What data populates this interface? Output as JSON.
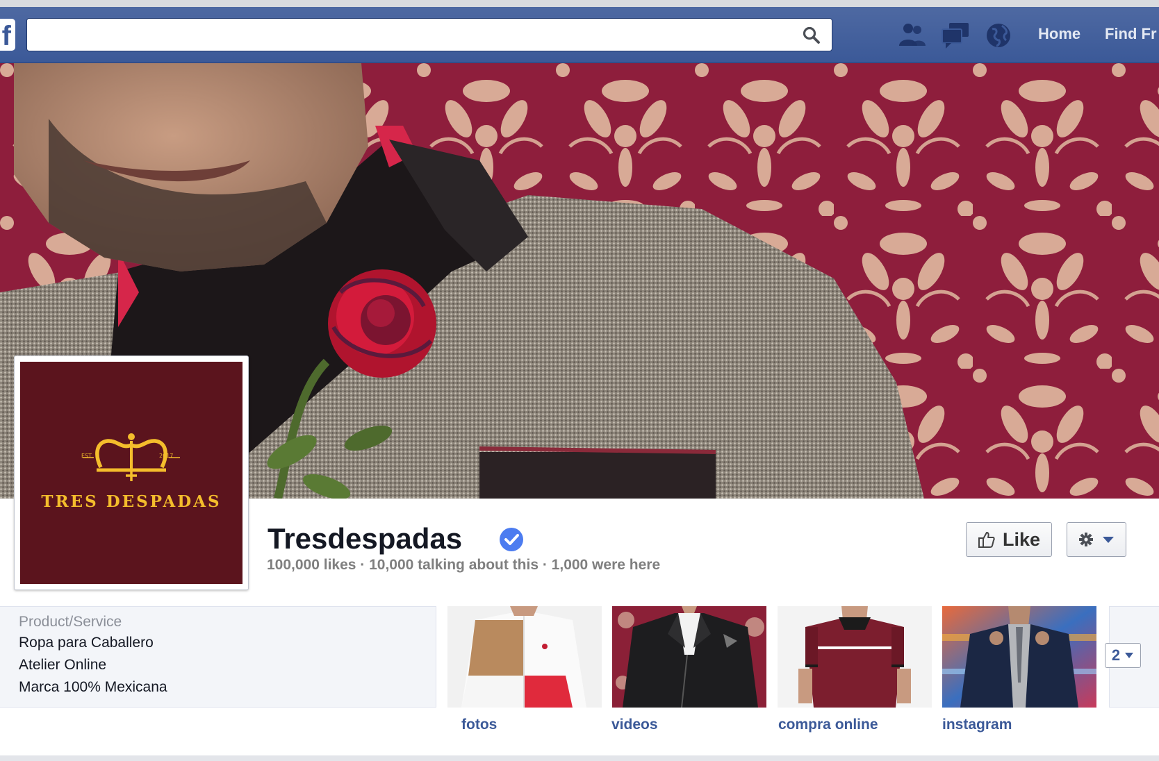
{
  "topbar": {
    "logo": "f",
    "search": {
      "value": "",
      "placeholder": ""
    },
    "nav": {
      "home": "Home",
      "find_friends": "Find Fr"
    },
    "icons": [
      "friend-requests-icon",
      "messages-icon",
      "notifications-globe-icon"
    ]
  },
  "cover": {
    "description_icon": "cover-photo"
  },
  "profile": {
    "brand_text": "TRES DESPADAS",
    "est_left": "EST.",
    "est_right": "2017",
    "background_color": "#5b141d",
    "accent_color": "#f4bd2c"
  },
  "page": {
    "name": "Tresdespadas",
    "stats": "100,000 likes · 10,000 talking about this · 1,000 were here",
    "like_label": "Like"
  },
  "about": {
    "category": "Product/Service",
    "lines": [
      "Ropa para Caballero",
      "Atelier Online",
      "Marca 100% Mexicana"
    ]
  },
  "apps": [
    {
      "label": "fotos"
    },
    {
      "label": "videos"
    },
    {
      "label": "compra online"
    },
    {
      "label": "instagram"
    }
  ],
  "more_count": "2",
  "colors": {
    "facebook_blue": "#3b5998",
    "cover_red": "#8c1f3c",
    "link": "#3b5998"
  }
}
